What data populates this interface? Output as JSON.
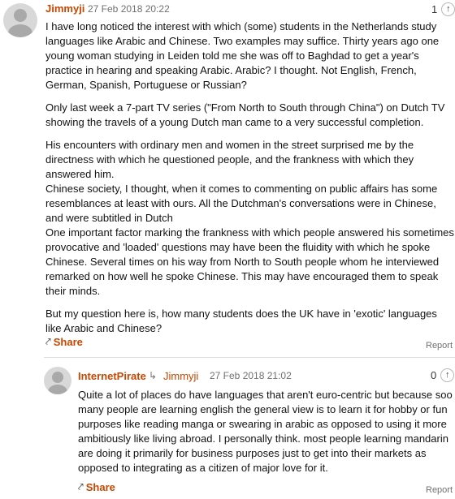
{
  "comment1": {
    "author": "Jimmyji",
    "timestamp": "27 Feb 2018 20:22",
    "recommend_count": "1",
    "paragraphs": [
      "I have long noticed the interest with which (some) students in the Netherlands study languages like Arabic and Chinese. Two examples may suffice. Thirty years ago one young woman studying in Leiden told me she was off to Baghdad to get a year's practice in hearing and speaking Arabic. Arabic? I thought. Not English, French, German, Spanish, Portuguese or Russian?",
      "Only last week a 7-part TV series (\"From North to South through China\") on Dutch TV showing the travels of a young Dutch man came to a very successful completion.",
      "His encounters with ordinary men and women in the street surprised me by the directness with which he questioned people, and the frankness with which they answered him.",
      "Chinese society, I thought, when it comes to commenting on public affairs has some resemblances at least with ours. All the Dutchman's conversations were in Chinese, and were subtitled in Dutch",
      "One important factor marking the frankness with which people answered his sometimes provocative and 'loaded' questions may have been the fluidity with which he spoke Chinese. Several times on his way from North to South people whom he interviewed remarked on how well he spoke Chinese. This may have encouraged them to speak their minds.",
      "But my question here is, how many students does the UK have in 'exotic' languages like Arabic and Chinese?"
    ],
    "share_label": "Share",
    "report_label": "Report"
  },
  "comment2": {
    "author": "InternetPirate",
    "reply_to": "Jimmyji",
    "timestamp": "27 Feb 2018 21:02",
    "recommend_count": "0",
    "paragraphs": [
      "Quite a lot of places do have languages that aren't euro-centric but because soo many people are learning english the general view is to learn it for hobby or fun purposes like reading manga or swearing in arabic as opposed to using it more ambitiously like living abroad. I personally think. most people learning mandarin are doing it primarily for business purposes just to get into their markets as opposed to integrating as a citizen of major love for it."
    ],
    "share_label": "Share",
    "report_label": "Report"
  },
  "icons": {
    "recommend": "arrow-up-icon",
    "share": "share-icon",
    "reply": "reply-arrow-icon"
  },
  "colors": {
    "accent": "#c74600",
    "muted": "#707070"
  }
}
